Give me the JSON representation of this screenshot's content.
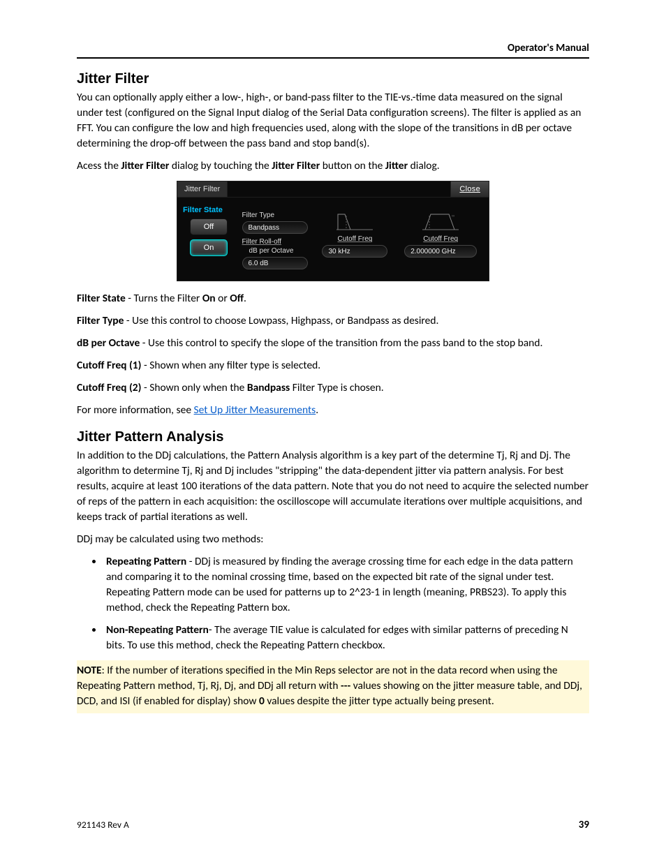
{
  "header": {
    "title": "Operator's Manual"
  },
  "section1": {
    "heading": "Jitter Filter",
    "para1": "You can optionally apply either a low-, high-, or band-pass filter to the TIE-vs.-time data measured on the signal under test (configured on the Signal Input dialog of the Serial Data configuration screens). The filter is applied as an FFT. You can configure the low and high frequencies used, along with the slope of the transitions in dB per octave determining the drop-off between the pass band and stop band(s).",
    "para2_pre": "Acess the ",
    "para2_b1": "Jitter Filter",
    "para2_mid1": " dialog by touching the ",
    "para2_b2": "Jitter Filter",
    "para2_mid2": " button on the ",
    "para2_b3": "Jitter",
    "para2_end": " dialog."
  },
  "dialog": {
    "tab": "Jitter Filter",
    "close": "Close",
    "filter_state_label": "Filter State",
    "off": "Off",
    "on": "On",
    "filter_type_label": "Filter Type",
    "filter_type_value": "Bandpass",
    "rolloff_label": "Filter Roll-off",
    "rolloff_sub": "dB per Octave",
    "rolloff_value": "6.0 dB",
    "cutoff1_label": "Cutoff Freq",
    "cutoff1_value": "30 kHz",
    "cutoff2_label": "Cutoff Freq",
    "cutoff2_value": "2.000000 GHz"
  },
  "defs": {
    "d1_t": "Filter State",
    "d1_b": " - Turns the Filter ",
    "d1_on": "On",
    "d1_or": " or ",
    "d1_off": "Off",
    "d1_end": ".",
    "d2_t": "Filter Type",
    "d2_b": " - Use this control to choose Lowpass, Highpass, or Bandpass as desired.",
    "d3_t": "dB per Octave",
    "d3_b": " - Use this control to specify the slope of the transition from the pass band to the stop band.",
    "d4_t": "Cutoff Freq (1)",
    "d4_b": " - Shown when any filter type is selected.",
    "d5_t": "Cutoff Freq (2)",
    "d5_b": " - Shown only when the ",
    "d5_bp": "Bandpass",
    "d5_end": " Filter Type is chosen.",
    "more_pre": "For more information, see ",
    "more_link": "Set Up Jitter Measurements",
    "more_end": "."
  },
  "section2": {
    "heading": "Jitter Pattern Analysis",
    "para1": "In addition to the DDj calculations, the Pattern Analysis algorithm is a key part of the determine Tj, Rj and Dj. The algorithm to determine Tj, Rj and Dj includes \"stripping\" the data-dependent jitter via pattern analysis. For best results, acquire at least 100 iterations of the data pattern. Note that you do not need to acquire the selected number of reps of the pattern in each acquisition: the oscilloscope will accumulate iterations over multiple acquisitions, and keeps track of partial iterations as well.",
    "para2": "DDj may be calculated using two methods:",
    "b1_t": "Repeating Pattern",
    "b1_b": " - DDj is measured by finding the average crossing time for each edge in the data pattern and comparing it to the nominal crossing time, based on the expected bit rate of the signal under test. Repeating Pattern mode can be used for patterns up to 2^23-1 in length (meaning, PRBS23). To apply this method, check the Repeating Pattern box.",
    "b2_t": "Non-Repeating Pattern",
    "b2_b": "- The average TIE value is calculated for edges with similar patterns of preceding N bits. To use this method, check the Repeating Pattern checkbox."
  },
  "note": {
    "label": "NOTE",
    "text1": ": If the number of iterations specified in the Min Reps selector are not in the data record when using the Repeating Pattern method, Tj, Rj, Dj, and DDj all return with ",
    "dashes": "---",
    "text2": " values showing on the jitter measure table, and DDj, DCD, and ISI (if enabled for display) show ",
    "zero": "0",
    "text3": " values despite the jitter type actually being present."
  },
  "footer": {
    "rev": "921143 Rev A",
    "page": "39"
  }
}
